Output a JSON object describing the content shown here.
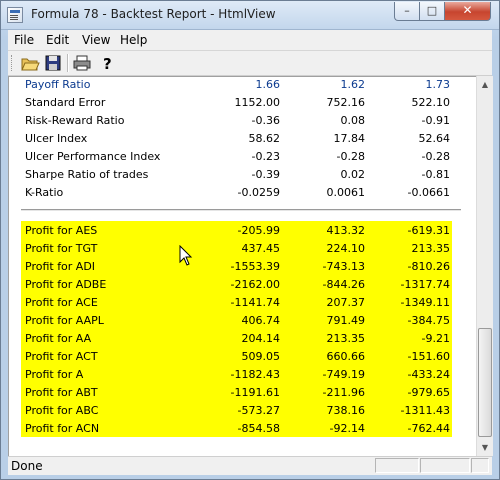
{
  "window": {
    "title": "Formula 78 - Backtest Report - HtmlView"
  },
  "caption": {
    "minimize": "–",
    "maximize": "□",
    "close": "✕"
  },
  "menu": [
    "File",
    "Edit",
    "View",
    "Help"
  ],
  "toolbar": {
    "icons": [
      "open-folder-icon",
      "save-disk-icon",
      "printer-icon",
      "help-question-icon"
    ]
  },
  "stats": [
    {
      "label": "Payoff Ratio",
      "values": [
        "1.66",
        "1.62",
        "1.73"
      ]
    },
    {
      "label": "Standard Error",
      "values": [
        "1152.00",
        "752.16",
        "522.10"
      ]
    },
    {
      "label": "Risk-Reward Ratio",
      "values": [
        "-0.36",
        "0.08",
        "-0.91"
      ]
    },
    {
      "label": "Ulcer Index",
      "values": [
        "58.62",
        "17.84",
        "52.64"
      ]
    },
    {
      "label": "Ulcer Performance Index",
      "values": [
        "-0.23",
        "-0.28",
        "-0.28"
      ]
    },
    {
      "label": "Sharpe Ratio of trades",
      "values": [
        "-0.39",
        "0.02",
        "-0.81"
      ]
    },
    {
      "label": "K-Ratio",
      "values": [
        "-0.0259",
        "0.0061",
        "-0.0661"
      ]
    }
  ],
  "profits": [
    {
      "label": "Profit for AES",
      "values": [
        "-205.99",
        "413.32",
        "-619.31"
      ]
    },
    {
      "label": "Profit for TGT",
      "values": [
        "437.45",
        "224.10",
        "213.35"
      ]
    },
    {
      "label": "Profit for ADI",
      "values": [
        "-1553.39",
        "-743.13",
        "-810.26"
      ]
    },
    {
      "label": "Profit for ADBE",
      "values": [
        "-2162.00",
        "-844.26",
        "-1317.74"
      ]
    },
    {
      "label": "Profit for ACE",
      "values": [
        "-1141.74",
        "207.37",
        "-1349.11"
      ]
    },
    {
      "label": "Profit for AAPL",
      "values": [
        "406.74",
        "791.49",
        "-384.75"
      ]
    },
    {
      "label": "Profit for AA",
      "values": [
        "204.14",
        "213.35",
        "-9.21"
      ]
    },
    {
      "label": "Profit for ACT",
      "values": [
        "509.05",
        "660.66",
        "-151.60"
      ]
    },
    {
      "label": "Profit for A",
      "values": [
        "-1182.43",
        "-749.19",
        "-433.24"
      ]
    },
    {
      "label": "Profit for ABT",
      "values": [
        "-1191.61",
        "-211.96",
        "-979.65"
      ]
    },
    {
      "label": "Profit for ABC",
      "values": [
        "-573.27",
        "738.16",
        "-1311.43"
      ]
    },
    {
      "label": "Profit for ACN",
      "values": [
        "-854.58",
        "-92.14",
        "-762.44"
      ]
    }
  ],
  "status": {
    "text": "Done"
  },
  "colors": {
    "highlight": "#ffff00",
    "title_bar": "#c9dcf0",
    "close_button": "#c7452f"
  }
}
